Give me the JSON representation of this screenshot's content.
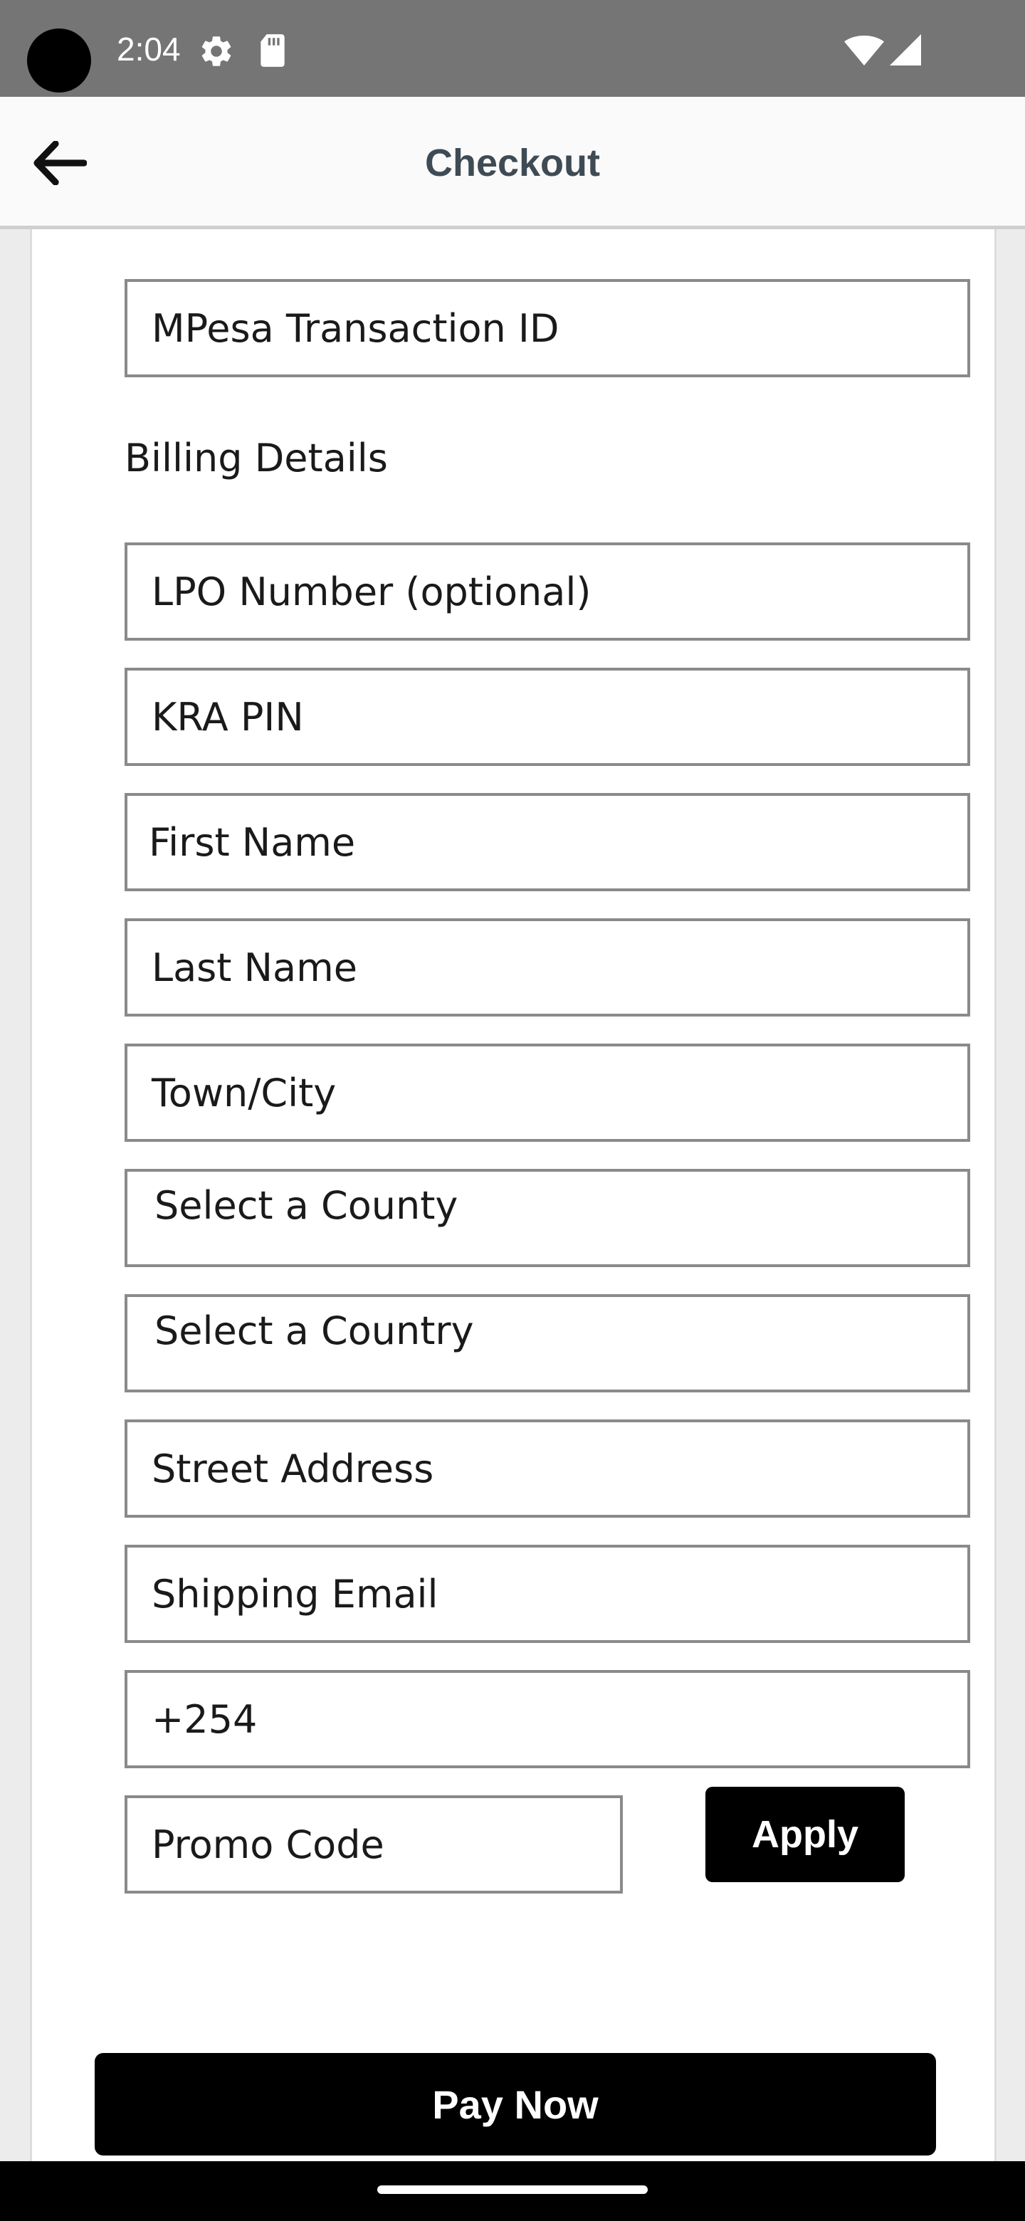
{
  "status_bar": {
    "time": "2:04",
    "icons": [
      "settings-gear-icon",
      "sd-card-icon",
      "wifi-icon",
      "cell-signal-icon"
    ]
  },
  "app_bar": {
    "back_icon": "arrow-left-icon",
    "title": "Checkout"
  },
  "form": {
    "mpesa_transaction_id": {
      "placeholder": "MPesa Transaction ID",
      "value": ""
    },
    "billing_section_title": "Billing Details",
    "lpo_number": {
      "placeholder": "LPO Number (optional)",
      "value": ""
    },
    "kra_pin": {
      "placeholder": "KRA PIN",
      "value": ""
    },
    "first_name": {
      "placeholder": "First Name",
      "value": ""
    },
    "last_name": {
      "placeholder": "Last Name",
      "value": ""
    },
    "town_city": {
      "placeholder": "Town/City",
      "value": ""
    },
    "county_select": {
      "selected": "Select a County"
    },
    "country_select": {
      "selected": "Select a Country"
    },
    "street_address": {
      "placeholder": "Street Address",
      "value": ""
    },
    "shipping_email": {
      "placeholder": "Shipping Email",
      "value": ""
    },
    "phone": {
      "value": "+254"
    },
    "promo_code": {
      "placeholder": "Promo Code",
      "value": ""
    },
    "apply_label": "Apply",
    "pay_now_label": "Pay Now"
  },
  "colors": {
    "status_bar": "#757575",
    "app_bar": "#fafafa",
    "title_text": "#3f4b54",
    "button_bg": "#000000",
    "button_text": "#ffffff",
    "field_border": "#8a8a8a"
  }
}
